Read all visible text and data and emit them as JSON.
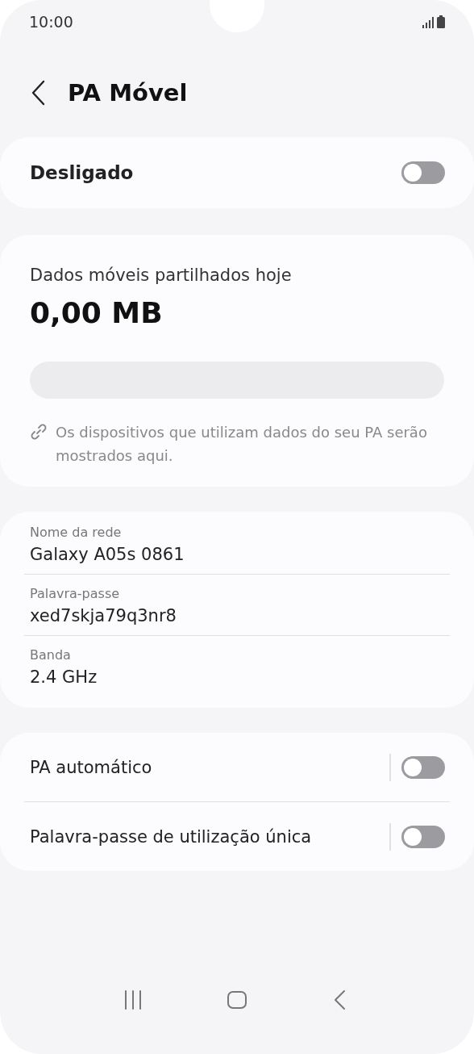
{
  "status_bar": {
    "time": "10:00"
  },
  "header": {
    "title": "PA Móvel"
  },
  "master_switch": {
    "label": "Desligado",
    "on": false
  },
  "usage": {
    "label": "Dados móveis partilhados hoje",
    "amount": "0,00 MB",
    "level": 0,
    "note": "Os dispositivos que utilizam dados do seu PA serão mostrados aqui."
  },
  "network": [
    {
      "label": "Nome da rede",
      "value": "Galaxy A05s 0861"
    },
    {
      "label": "Palavra-passe",
      "value": "xed7skja79q3nr8"
    },
    {
      "label": "Banda",
      "value": "2.4 GHz"
    }
  ],
  "options": [
    {
      "label": "PA automático",
      "on": false
    },
    {
      "label": "Palavra-passe de utilização única",
      "on": false
    }
  ]
}
